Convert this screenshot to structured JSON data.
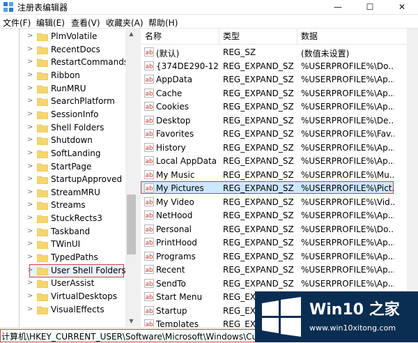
{
  "window": {
    "title": "注册表编辑器",
    "minimize_glyph": "—",
    "maximize_glyph": "☐",
    "close_glyph": "✕"
  },
  "menu": [
    {
      "label": "文件(F)"
    },
    {
      "label": "编辑(E)"
    },
    {
      "label": "查看(V)"
    },
    {
      "label": "收藏夹(A)"
    },
    {
      "label": "帮助(H)"
    }
  ],
  "tree": {
    "items": [
      {
        "label": "PlmVolatile"
      },
      {
        "label": "RecentDocs"
      },
      {
        "label": "RestartCommands"
      },
      {
        "label": "Ribbon"
      },
      {
        "label": "RunMRU"
      },
      {
        "label": "SearchPlatform"
      },
      {
        "label": "SessionInfo"
      },
      {
        "label": "Shell Folders"
      },
      {
        "label": "Shutdown"
      },
      {
        "label": "SoftLanding"
      },
      {
        "label": "StartPage"
      },
      {
        "label": "StartupApproved"
      },
      {
        "label": "StreamMRU"
      },
      {
        "label": "Streams"
      },
      {
        "label": "StuckRects3"
      },
      {
        "label": "Taskband"
      },
      {
        "label": "TWinUI"
      },
      {
        "label": "TypedPaths"
      },
      {
        "label": "User Shell Folders",
        "selected": true
      },
      {
        "label": "UserAssist"
      },
      {
        "label": "VirtualDesktops"
      },
      {
        "label": "VisualEffects"
      }
    ]
  },
  "list": {
    "columns": [
      {
        "label": "名称"
      },
      {
        "label": "类型"
      },
      {
        "label": "数据"
      }
    ],
    "rows": [
      {
        "name": "(默认)",
        "type": "REG_SZ",
        "data": "(数值未设置)"
      },
      {
        "name": "{374DE290-12...",
        "type": "REG_EXPAND_SZ",
        "data": "%USERPROFILE%\\Do..."
      },
      {
        "name": "AppData",
        "type": "REG_EXPAND_SZ",
        "data": "%USERPROFILE%\\Ap..."
      },
      {
        "name": "Cache",
        "type": "REG_EXPAND_SZ",
        "data": "%USERPROFILE%\\Ap..."
      },
      {
        "name": "Cookies",
        "type": "REG_EXPAND_SZ",
        "data": "%USERPROFILE%\\Ap..."
      },
      {
        "name": "Desktop",
        "type": "REG_EXPAND_SZ",
        "data": "%USERPROFILE%\\De..."
      },
      {
        "name": "Favorites",
        "type": "REG_EXPAND_SZ",
        "data": "%USERPROFILE%\\Fav..."
      },
      {
        "name": "History",
        "type": "REG_EXPAND_SZ",
        "data": "%USERPROFILE%\\Ap..."
      },
      {
        "name": "Local AppData",
        "type": "REG_EXPAND_SZ",
        "data": "%USERPROFILE%\\Ap..."
      },
      {
        "name": "My Music",
        "type": "REG_EXPAND_SZ",
        "data": "%USERPROFILE%\\Mu..."
      },
      {
        "name": "My Pictures",
        "type": "REG_EXPAND_SZ",
        "data": "%USERPROFILE%\\Pict...",
        "selected": true
      },
      {
        "name": "My Video",
        "type": "REG_EXPAND_SZ",
        "data": "%USERPROFILE%\\Vid..."
      },
      {
        "name": "NetHood",
        "type": "REG_EXPAND_SZ",
        "data": "%USERPROFILE%\\Ap..."
      },
      {
        "name": "Personal",
        "type": "REG_EXPAND_SZ",
        "data": "%USERPROFILE%\\Do..."
      },
      {
        "name": "PrintHood",
        "type": "REG_EXPAND_SZ",
        "data": "%USERPROFILE%\\Ap..."
      },
      {
        "name": "Programs",
        "type": "REG_EXPAND_SZ",
        "data": "%USERPROFILE%\\Ap..."
      },
      {
        "name": "Recent",
        "type": "REG_EXPAND_SZ",
        "data": "%USERPROFILE%\\Ap..."
      },
      {
        "name": "SendTo",
        "type": "REG_EXPAND_SZ",
        "data": "%USERPROFILE%\\Ap..."
      },
      {
        "name": "Start Menu",
        "type": "REG_EX",
        "data": ""
      },
      {
        "name": "Startup",
        "type": "REG_EX",
        "data": ""
      },
      {
        "name": "Templates",
        "type": "REG_EX",
        "data": ""
      }
    ]
  },
  "status": {
    "path": "计算机\\HKEY_CURRENT_USER\\Software\\Microsoft\\Windows\\Current"
  },
  "watermark": {
    "title": "Win10 之家",
    "url": "www.win10xitong.com"
  },
  "colors": {
    "highlight_border": "#d04040",
    "selection_fill": "#cce8ff",
    "folder": "#f5d66e",
    "watermark_bg": "#0a2d52"
  }
}
